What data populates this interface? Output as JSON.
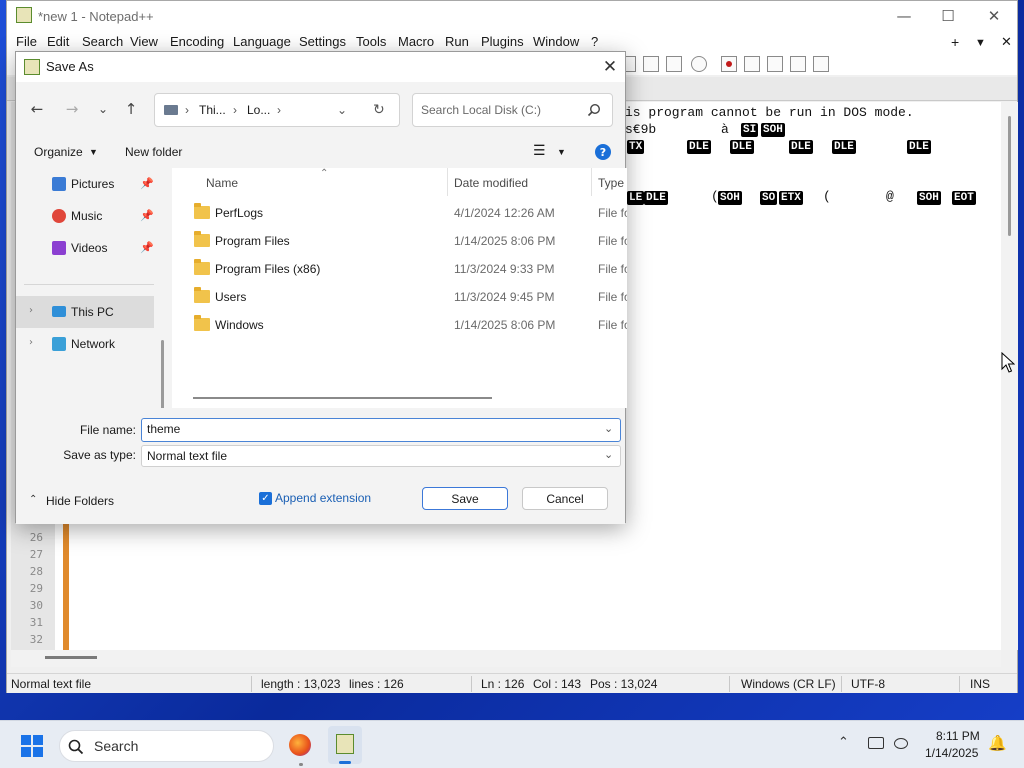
{
  "notepad": {
    "title": "*new 1 - Notepad++",
    "controls": {
      "minimize": "—",
      "maximize": "☐",
      "close": "✕"
    },
    "menu": [
      "File",
      "Edit",
      "Search",
      "View",
      "Encoding",
      "Language",
      "Settings",
      "Tools",
      "Macro",
      "Run",
      "Plugins",
      "Window",
      "?"
    ],
    "menu_right": {
      "plus": "+",
      "dropdown": "▼",
      "close": "✕"
    },
    "editor": {
      "line1": "is program cannot be run in DOS mode.",
      "line2_text": "s€9b",
      "line2_char": "à",
      "ctrl": {
        "si": "SI",
        "soh": "SOH",
        "tx": "TX",
        "dle": "DLE",
        "etx": "ETX",
        "so": "SO",
        "eot": "EOT",
        "le": "LE"
      },
      "chars": {
        "paren": "(",
        "paren2": "(",
        "at": "@"
      },
      "line_numbers": [
        "26",
        "27",
        "28",
        "29",
        "30",
        "31",
        "32"
      ]
    },
    "status": {
      "file_type": "Normal text file",
      "length": "length : 13,023",
      "lines": "lines : 126",
      "ln": "Ln : 126",
      "col": "Col : 143",
      "pos": "Pos : 13,024",
      "eol": "Windows (CR LF)",
      "encoding": "UTF-8",
      "mode": "INS"
    }
  },
  "dialog": {
    "title": "Save As",
    "close": "✕",
    "nav": {
      "back": "←",
      "forward": "→",
      "recent": "⌄",
      "up": "↑",
      "refresh": "↻"
    },
    "breadcrumb": [
      "Thi...",
      "Lo..."
    ],
    "breadcrumb_sep": "›",
    "search_placeholder": "Search Local Disk (C:)",
    "commands": {
      "organize": "Organize",
      "new_folder": "New folder",
      "view": "☰",
      "help": "?"
    },
    "nav_pane": {
      "quick": [
        {
          "label": "Pictures",
          "icon": "pictures-icon",
          "color": "#3a7bd5"
        },
        {
          "label": "Music",
          "icon": "music-icon",
          "color": "#e0463a"
        },
        {
          "label": "Videos",
          "icon": "videos-icon",
          "color": "#8b3fd1"
        }
      ],
      "tree": [
        {
          "label": "This PC",
          "icon": "computer-icon",
          "color": "#2f8fd8"
        },
        {
          "label": "Network",
          "icon": "network-icon",
          "color": "#3aa0d8"
        }
      ]
    },
    "columns": {
      "name": "Name",
      "date": "Date modified",
      "type": "Type"
    },
    "files": [
      {
        "name": "PerfLogs",
        "date": "4/1/2024 12:26 AM",
        "type": "File folder"
      },
      {
        "name": "Program Files",
        "date": "1/14/2025 8:06 PM",
        "type": "File folder"
      },
      {
        "name": "Program Files (x86)",
        "date": "11/3/2024 9:33 PM",
        "type": "File folder"
      },
      {
        "name": "Users",
        "date": "11/3/2024 9:45 PM",
        "type": "File folder"
      },
      {
        "name": "Windows",
        "date": "1/14/2025 8:06 PM",
        "type": "File folder"
      }
    ],
    "form": {
      "file_name_label": "File name:",
      "file_name_value": "theme",
      "save_type_label": "Save as type:",
      "save_type_value": "Normal text file",
      "hide_folders": "Hide Folders",
      "append_extension": "Append extension",
      "save": "Save",
      "cancel": "Cancel"
    }
  },
  "taskbar": {
    "search_label": "Search",
    "time": "8:11 PM",
    "date": "1/14/2025",
    "tray": {
      "chevron": "⌃",
      "bell": "🔔"
    }
  }
}
